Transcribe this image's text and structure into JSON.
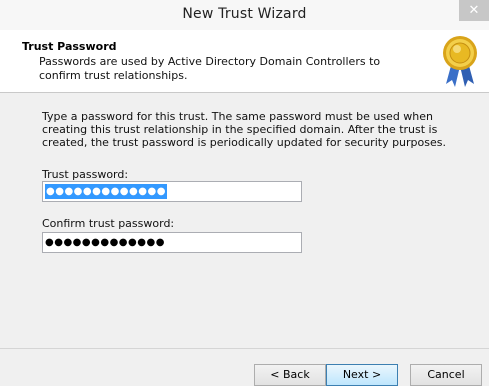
{
  "window": {
    "title": "New Trust Wizard",
    "close_glyph": "✕"
  },
  "header": {
    "title": "Trust Password",
    "subtitle": "Passwords are used by Active Directory Domain Controllers to confirm trust relationships.",
    "icon": "award-seal-icon"
  },
  "body": {
    "instructions": "Type a password for this trust. The same password must be used when creating this trust relationship in the specified domain. After the trust is created, the trust password is periodically updated for security purposes."
  },
  "form": {
    "password_label": "Trust password:",
    "password_value": "●●●●●●●●●●●●●",
    "confirm_label": "Confirm trust password:",
    "confirm_value": "●●●●●●●●●●●●●"
  },
  "buttons": {
    "back": "< Back",
    "next": "Next >",
    "cancel": "Cancel"
  },
  "colors": {
    "selection": "#3399ff",
    "seal_gold": "#e8b923",
    "ribbon_blue": "#3a6fc8"
  }
}
